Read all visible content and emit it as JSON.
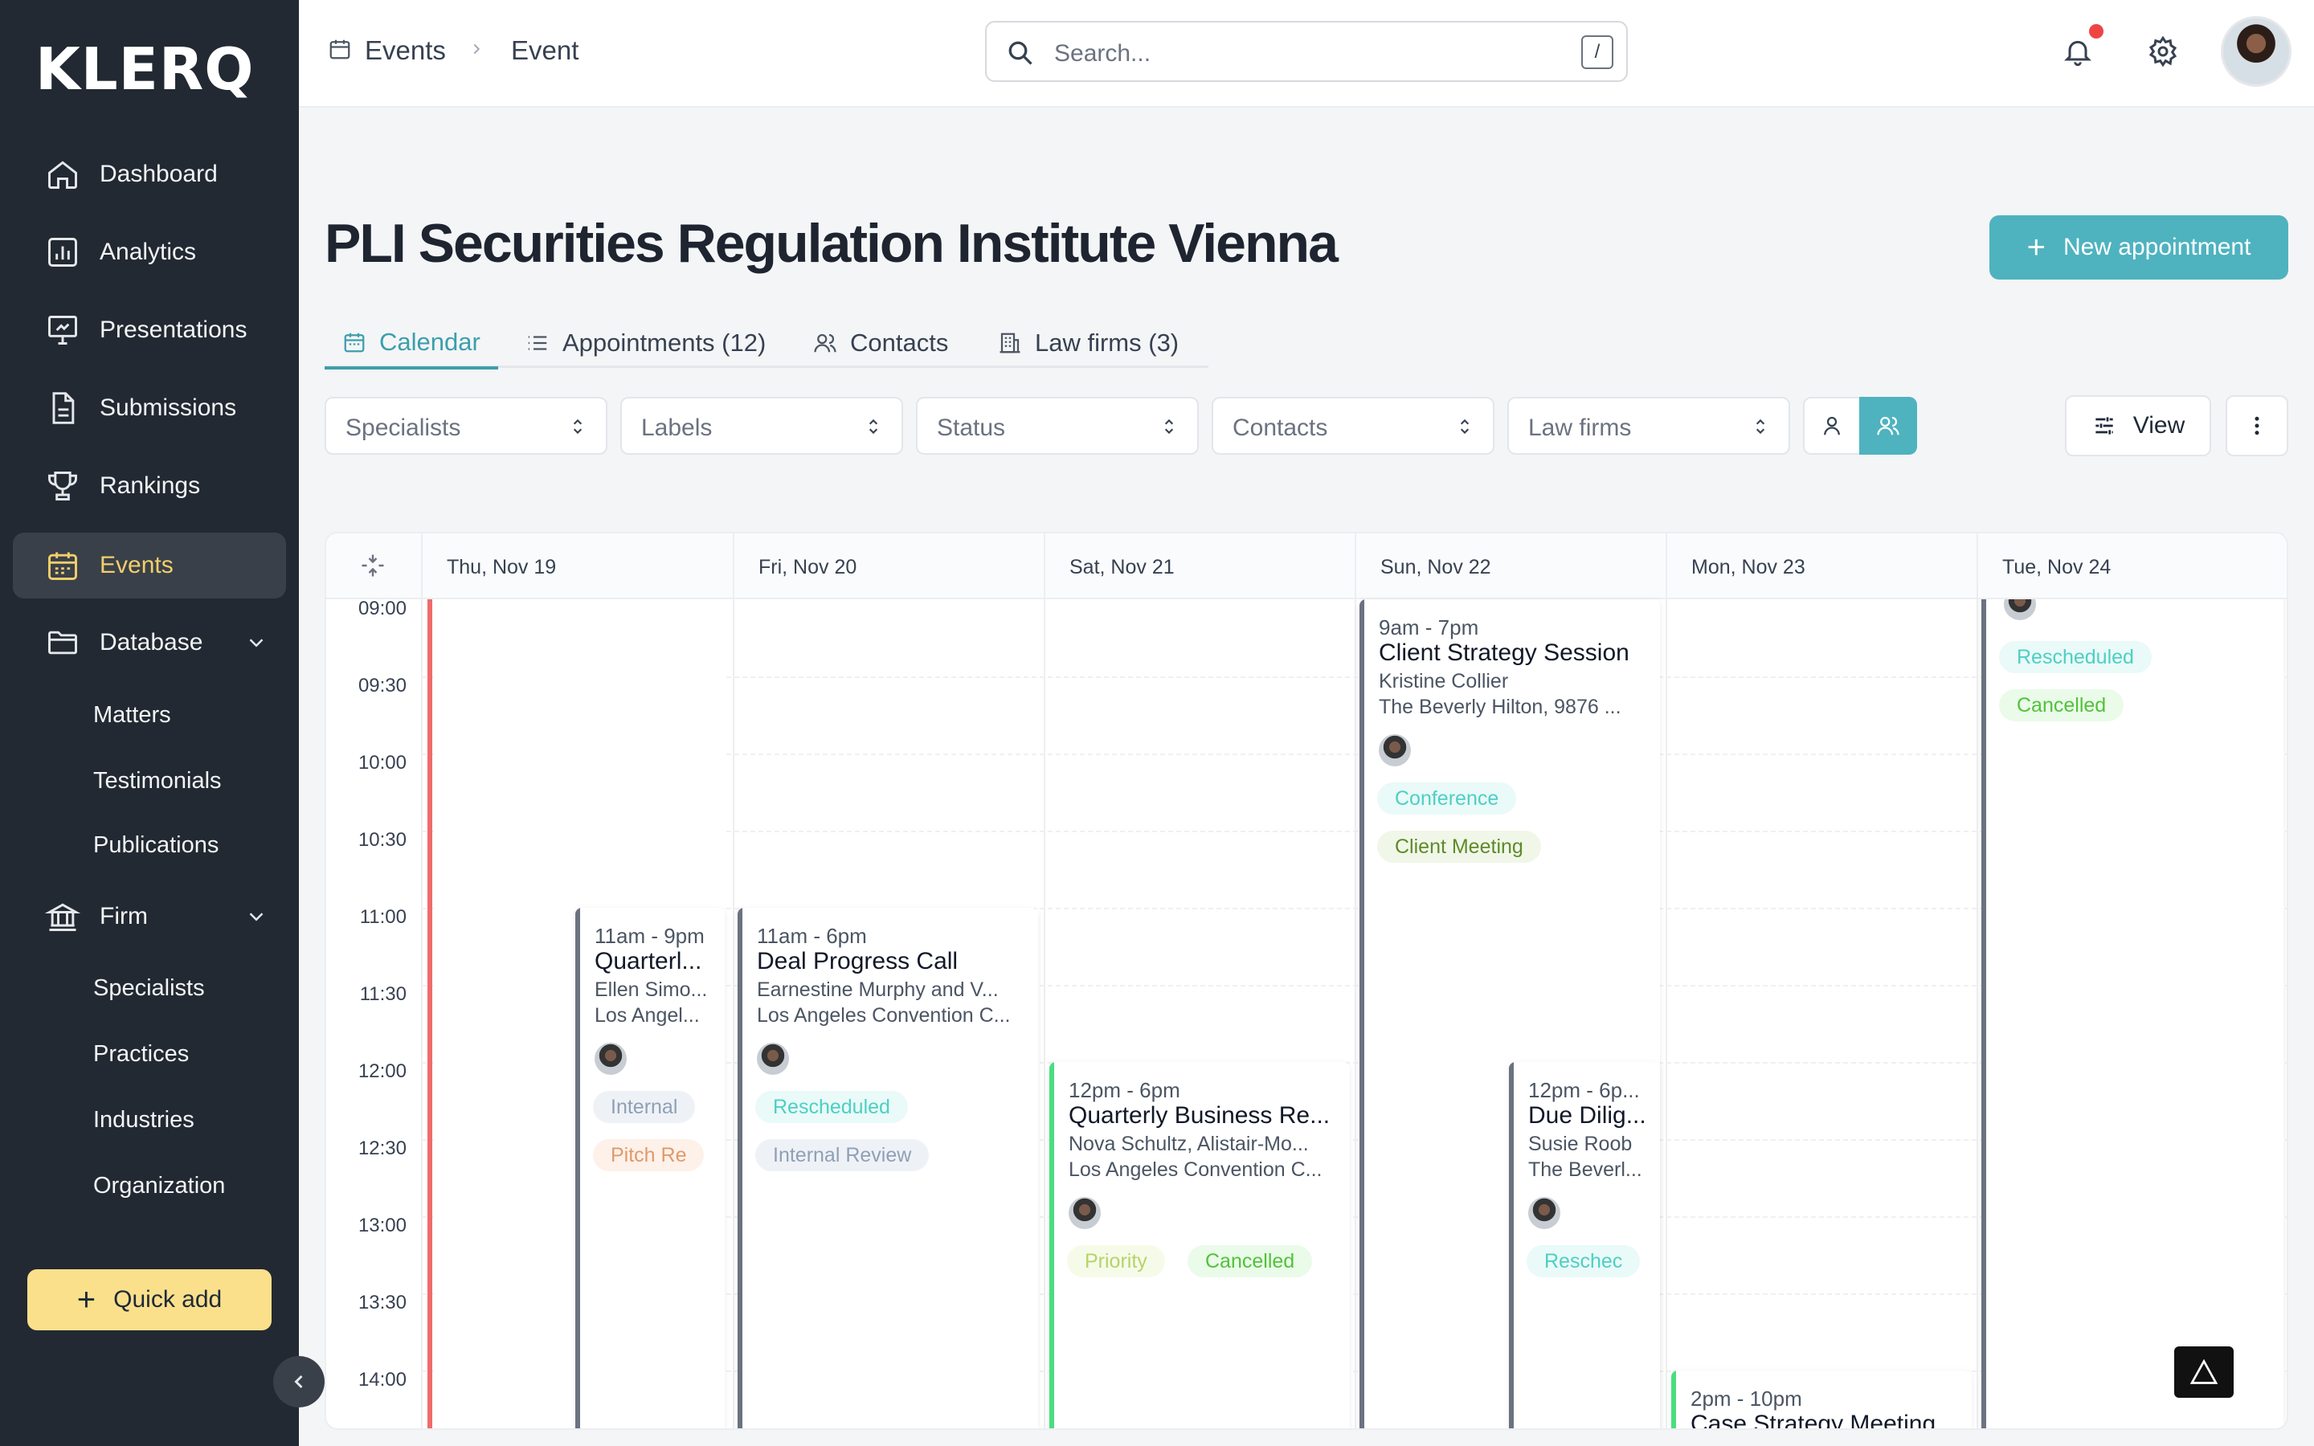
{
  "app": {
    "logo": "KLERQ"
  },
  "sidebar": {
    "items": [
      {
        "label": "Dashboard",
        "icon": "home-icon"
      },
      {
        "label": "Analytics",
        "icon": "analytics-icon"
      },
      {
        "label": "Presentations",
        "icon": "presentation-icon"
      },
      {
        "label": "Submissions",
        "icon": "document-icon"
      },
      {
        "label": "Rankings",
        "icon": "trophy-icon"
      },
      {
        "label": "Events",
        "icon": "calendar-icon",
        "active": true
      },
      {
        "label": "Database",
        "icon": "folder-icon",
        "expandable": true
      },
      {
        "label": "Firm",
        "icon": "bank-icon",
        "expandable": true
      }
    ],
    "database_sub": [
      "Matters",
      "Testimonials",
      "Publications"
    ],
    "firm_sub": [
      "Specialists",
      "Practices",
      "Industries",
      "Organization"
    ],
    "quick_add": "Quick add",
    "accent_color": "#f2cf6b"
  },
  "header": {
    "breadcrumb": [
      "Events",
      "Event"
    ],
    "search_placeholder": "Search...",
    "search_shortcut": "/",
    "has_notification": true
  },
  "page": {
    "title": "PLI Securities Regulation Institute Vienna",
    "new_appointment": "New appointment",
    "tabs": [
      {
        "label": "Calendar",
        "icon": "calendar-icon",
        "active": true
      },
      {
        "label": "Appointments (12)",
        "icon": "list-icon"
      },
      {
        "label": "Contacts",
        "icon": "contacts-icon"
      },
      {
        "label": "Law firms (3)",
        "icon": "building-icon"
      }
    ],
    "filters": [
      "Specialists",
      "Labels",
      "Status",
      "Contacts",
      "Law firms"
    ],
    "view_label": "View",
    "accent_color": "#4eb3bf"
  },
  "calendar": {
    "days": [
      "Thu, Nov 19",
      "Fri, Nov 20",
      "Sat, Nov 21",
      "Sun, Nov 22",
      "Mon, Nov 23",
      "Tue, Nov 24"
    ],
    "times": [
      "09:00",
      "09:30",
      "10:00",
      "10:30",
      "11:00",
      "11:30",
      "12:00",
      "12:30",
      "13:00",
      "13:30",
      "14:00"
    ],
    "events": [
      {
        "time": "9am - 7pm",
        "title": "Client Strategy Session",
        "line1": "Kristine Collier",
        "line2": "The Beverly Hilton, 9876 ...",
        "tags": [
          "Conference",
          "Client Meeting"
        ]
      },
      {
        "time": "11am - 9pm",
        "title": "Quarterl...",
        "line1": "Ellen Simo...",
        "line2": "Los Angel...",
        "tags": [
          "Internal",
          "Pitch Re"
        ]
      },
      {
        "time": "11am - 6pm",
        "title": "Deal Progress Call",
        "line1": "Earnestine Murphy and V...",
        "line2": "Los Angeles Convention C...",
        "tags": [
          "Rescheduled",
          "Internal Review"
        ]
      },
      {
        "time": "12pm - 6pm",
        "title": "Quarterly Business Re...",
        "line1": "Nova Schultz, Alistair-Mo...",
        "line2": "Los Angeles Convention C...",
        "tags": [
          "Priority",
          "Cancelled"
        ]
      },
      {
        "time": "12pm - 6p...",
        "title": "Due Dilig...",
        "line1": "Susie Roob",
        "line2": "The Beverl...",
        "tags": [
          "Reschec"
        ]
      },
      {
        "time": "2pm - 10pm",
        "title": "Case Strategy Meeting"
      },
      {
        "tags": [
          "Rescheduled",
          "Cancelled"
        ]
      }
    ]
  }
}
